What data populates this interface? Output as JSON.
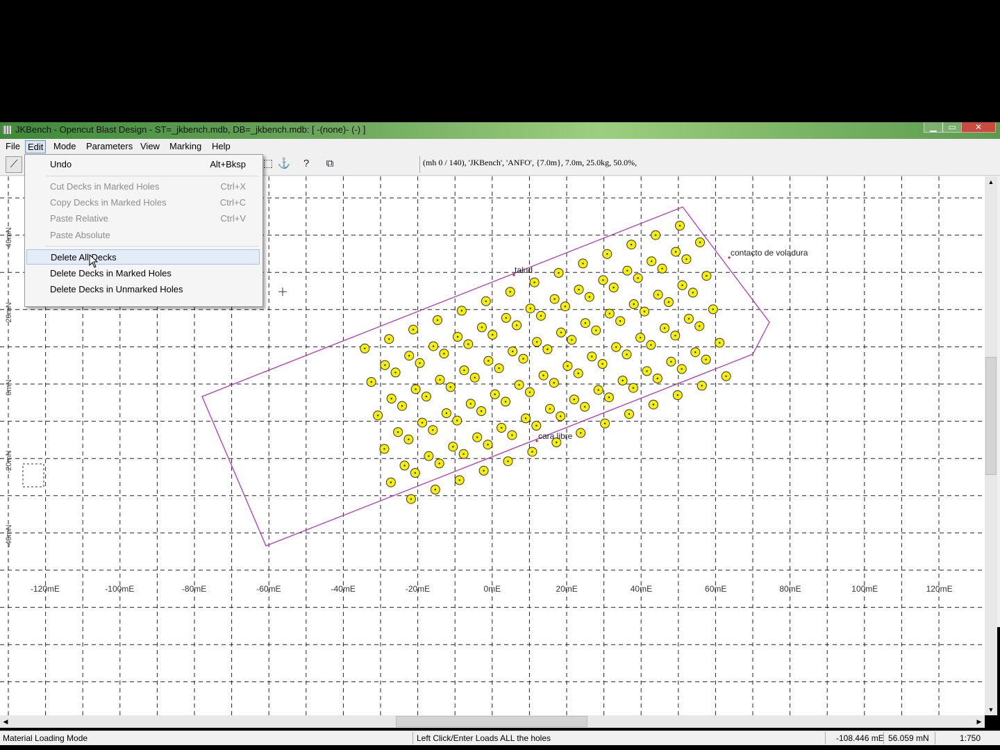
{
  "window": {
    "title": "JKBench - Opencut Blast Design - ST=_jkbench.mdb, DB=_jkbench.mdb: [ -(none)- (-) ]",
    "controls": {
      "minimize": "▁",
      "maximize": "▭",
      "close": "✕"
    }
  },
  "menubar": [
    "File",
    "Edit",
    "Mode",
    "Parameters",
    "View",
    "Marking",
    "Help"
  ],
  "toolbar": {
    "info": "(mh 0 / 140), 'JKBench', 'ANFO',  {7.0m}, 7.0m, 25.0kg, 50.0%,",
    "icons": [
      "line-tool-icon",
      "select-box-icon",
      "anchor-icon",
      "help-pointer-icon",
      "copy-icon"
    ]
  },
  "edit_menu": {
    "items": [
      {
        "label": "Undo",
        "shortcut": "Alt+Bksp",
        "enabled": true
      },
      {
        "label": "Cut Decks in Marked Holes",
        "shortcut": "Ctrl+X",
        "enabled": false
      },
      {
        "label": "Copy Decks in Marked Holes",
        "shortcut": "Ctrl+C",
        "enabled": false
      },
      {
        "label": "Paste Relative",
        "shortcut": "Ctrl+V",
        "enabled": false
      },
      {
        "label": "Paste Absolute",
        "shortcut": "",
        "enabled": false
      },
      {
        "label": "Delete All Decks",
        "shortcut": "",
        "enabled": true
      },
      {
        "label": "Delete Decks in Marked Holes",
        "shortcut": "",
        "enabled": true
      },
      {
        "label": "Delete Decks in Unmarked Holes",
        "shortcut": "",
        "enabled": true
      }
    ],
    "highlighted": "Delete All Decks"
  },
  "plot": {
    "x_labels": [
      "-120mE",
      "-100mE",
      "-80mE",
      "-60mE",
      "-40mE",
      "-20mE",
      "0mE",
      "20mE",
      "40mE",
      "60mE",
      "80mE",
      "100mE",
      "120mE"
    ],
    "y_labels": [
      "40mN",
      "20mN",
      "0mN",
      "-20mN",
      "-40mN"
    ],
    "annotations": [
      "contacto de voladura",
      "talud",
      "cara libre"
    ],
    "colors": {
      "boundary": "#b03ab0",
      "hole_fill": "#f6f000",
      "hole_stroke": "#333333",
      "grid": "#222222"
    },
    "hole_count": 140
  },
  "status": {
    "mode": "Material Loading Mode",
    "hint": "Left Click/Enter Loads ALL the holes",
    "east": "-108.446 mE",
    "north": "56.059 mN",
    "scale": "1:750"
  }
}
